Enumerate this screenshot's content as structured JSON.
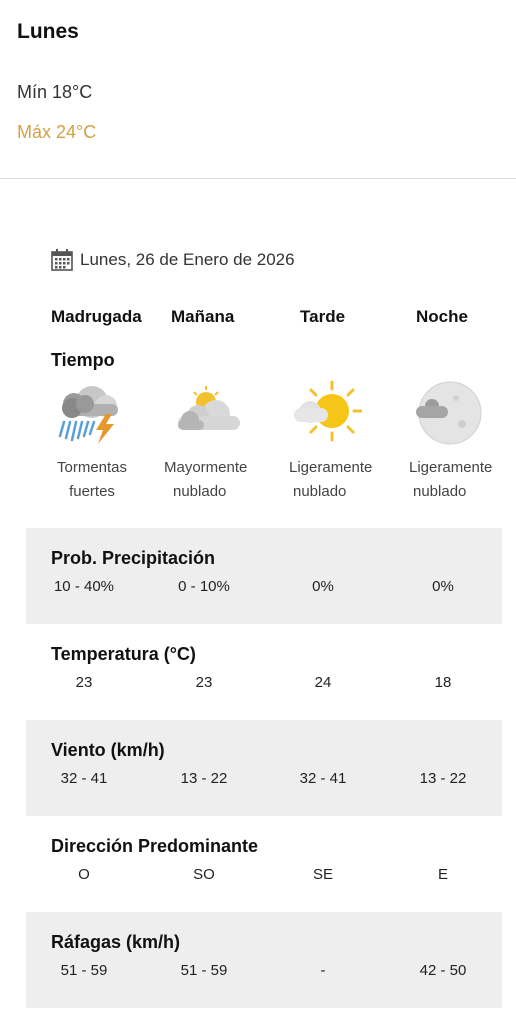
{
  "header": {
    "day": "Lunes",
    "min": "Mín 18°C",
    "max": "Máx 24°C",
    "max_color": "#d4a046"
  },
  "date": {
    "icon": "calendar-icon",
    "text": "Lunes, 26 de Enero de 2026"
  },
  "periods": [
    "Madrugada",
    "Mañana",
    "Tarde",
    "Noche"
  ],
  "tiempo": {
    "label": "Tiempo",
    "items": [
      {
        "icon": "thunderstorm-icon",
        "line1": "Tormentas",
        "line2": "fuertes"
      },
      {
        "icon": "mostly-cloudy-day-icon",
        "line1": "Mayormente",
        "line2": "nublado"
      },
      {
        "icon": "partly-cloudy-day-icon",
        "line1": "Ligeramente",
        "line2": "nublado"
      },
      {
        "icon": "partly-cloudy-night-icon",
        "line1": "Ligeramente",
        "line2": "nublado"
      }
    ]
  },
  "rows": [
    {
      "title": "Prob. Precipitación",
      "values": [
        "10 - 40%",
        "0 - 10%",
        "0%",
        "0%"
      ]
    },
    {
      "title": "Temperatura (°C)",
      "values": [
        "23",
        "23",
        "24",
        "18"
      ]
    },
    {
      "title": "Viento (km/h)",
      "values": [
        "32 - 41",
        "13 - 22",
        "32 - 41",
        "13 - 22"
      ]
    },
    {
      "title": "Dirección Predominante",
      "values": [
        "O",
        "SO",
        "SE",
        "E"
      ]
    },
    {
      "title": "Ráfagas (km/h)",
      "values": [
        "51 - 59",
        "51 - 59",
        "-",
        "42 - 50"
      ]
    }
  ]
}
